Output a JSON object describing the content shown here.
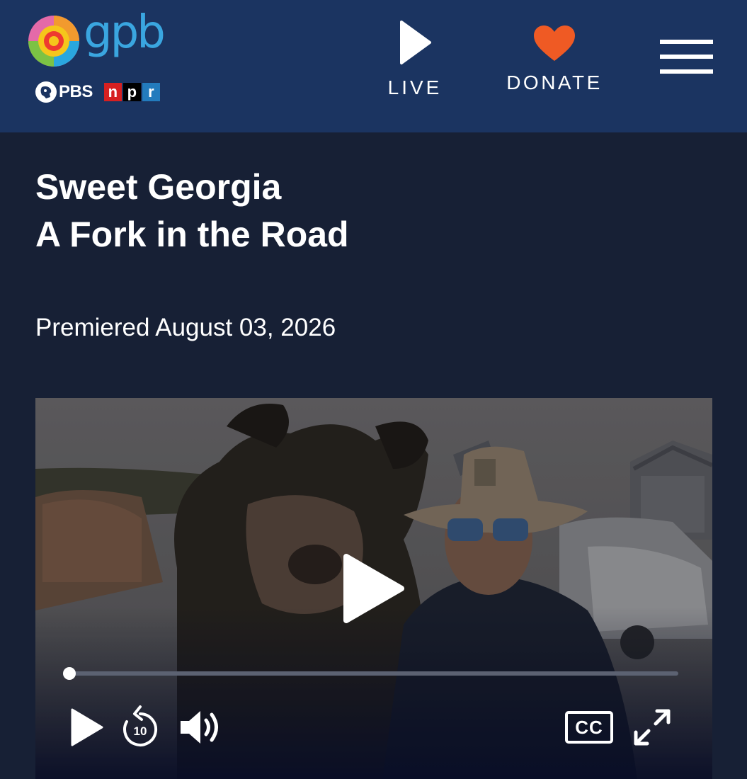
{
  "header": {
    "logo_text": "gpb",
    "partner_pbs": "PBS",
    "partner_npr": [
      "n",
      "p",
      "r"
    ],
    "nav_live_label": "LIVE",
    "nav_donate_label": "DONATE",
    "icons": {
      "logo": "gpb-logo-icon",
      "pbs": "pbs-head-icon",
      "live": "play-icon",
      "donate": "heart-icon",
      "menu": "hamburger-menu-icon"
    },
    "colors": {
      "background": "#1b3461",
      "logo_text": "#3aa6e0",
      "heart": "#ef5a24",
      "npr_n": "#d62021",
      "npr_p": "#000000",
      "npr_r": "#237bbd"
    }
  },
  "program": {
    "title": "Sweet Georgia",
    "episode": "A Fork in the Road",
    "premiered": "Premiered August 03, 2026"
  },
  "player": {
    "progress": 0,
    "closed_captions_label": "CC",
    "rewind_seconds": "10",
    "icons": {
      "big_play": "play-icon",
      "play": "play-icon",
      "rewind": "rewind-10-icon",
      "volume": "volume-icon",
      "captions": "closed-captions-icon",
      "fullscreen": "fullscreen-icon"
    }
  },
  "page_colors": {
    "background": "#172035"
  }
}
